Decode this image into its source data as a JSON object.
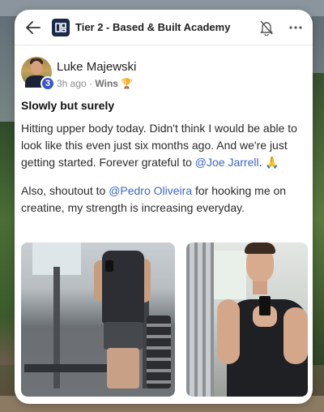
{
  "header": {
    "title": "Tier 2 - Based & Built Academy",
    "back_icon": "arrow-left-icon",
    "logo_icon": "group-logo-icon",
    "bell_icon": "bell-off-icon",
    "more_icon": "more-horizontal-icon"
  },
  "post": {
    "author": {
      "name": "Luke Majewski",
      "level": "3"
    },
    "time": "3h ago",
    "separator": "·",
    "category": "Wins",
    "category_icon": "trophy-icon",
    "title": "Slowly but surely",
    "body": {
      "p1_before": "Hitting upper body today. Didn't think I would be able to look like this even just six months ago. And we're just getting started. Forever grateful to ",
      "p1_mention": "@Joe Jarrell",
      "p1_after": ". 🙏",
      "p2_before": "Also, shoutout to ",
      "p2_mention": "@Pedro Oliveira",
      "p2_after": " for hooking me on creatine, my strength is increasing everyday."
    }
  },
  "colors": {
    "mention": "#3d66c7",
    "badge": "#3a55c5",
    "logo_bg": "#1c2a4a"
  }
}
